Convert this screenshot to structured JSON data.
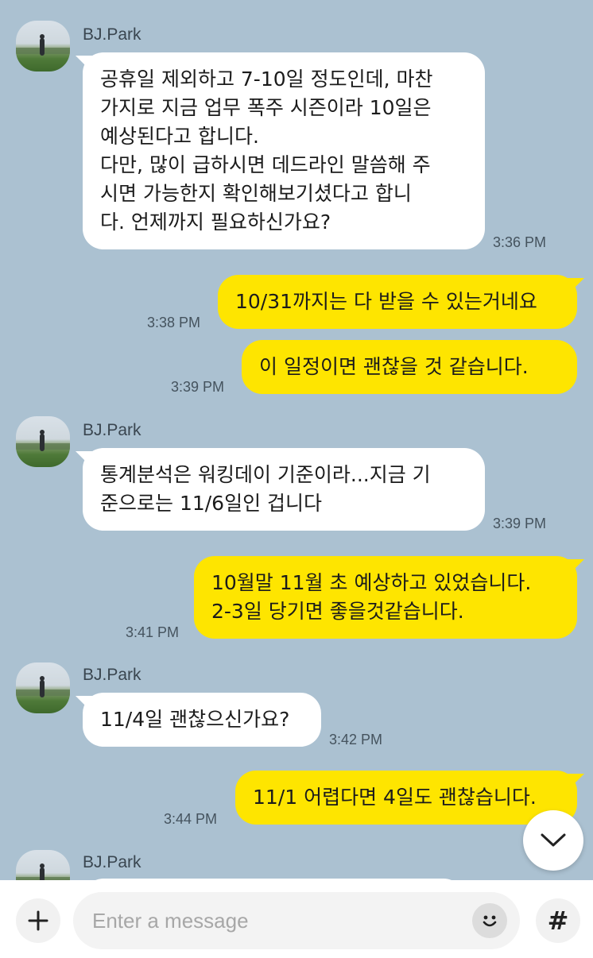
{
  "colors": {
    "background": "#abc1d1",
    "incoming_bubble": "#ffffff",
    "outgoing_bubble": "#fee500",
    "time_text": "#45535e"
  },
  "messages": [
    {
      "sender": "BJ.Park",
      "direction": "incoming",
      "lines": [
        "공휴일 제외하고 7-10일 정도인데, 마찬",
        "가지로 지금 업무 폭주 시즌이라 10일은",
        "예상된다고 합니다.",
        "다만, 많이 급하시면 데드라인 말씀해 주",
        "시면 가능한지 확인해보기셨다고 합니",
        "다. 언제까지 필요하신가요?"
      ],
      "time": "3:36 PM"
    },
    {
      "direction": "outgoing",
      "lines": [
        "10/31까지는 다 받을 수 있는거네요"
      ],
      "time": "3:38 PM"
    },
    {
      "direction": "outgoing",
      "lines": [
        "이 일정이면 괜찮을 것 같습니다."
      ],
      "time": "3:39 PM"
    },
    {
      "sender": "BJ.Park",
      "direction": "incoming",
      "lines": [
        "통계분석은 워킹데이 기준이라...지금 기",
        "준으로는 11/6일인 겁니다"
      ],
      "time": "3:39 PM"
    },
    {
      "direction": "outgoing",
      "lines": [
        "10월말 11월 초 예상하고 있었습니다.",
        "2-3일 당기면 좋을것같습니다."
      ],
      "time": "3:41 PM"
    },
    {
      "sender": "BJ.Park",
      "direction": "incoming",
      "lines": [
        "11/4일 괜찮으신가요?"
      ],
      "time": "3:42 PM"
    },
    {
      "direction": "outgoing",
      "lines": [
        "11/1 어렵다면 4일도 괜찮습니다."
      ],
      "time": "3:44 PM"
    },
    {
      "sender": "BJ.Park",
      "direction": "incoming",
      "lines": [],
      "time": ""
    }
  ],
  "input": {
    "placeholder": "Enter a message",
    "value": ""
  },
  "icons": {
    "add": "plus-icon",
    "emoji": "smile-icon",
    "hashtag": "hash-icon",
    "scroll_down": "chevron-down-icon"
  },
  "labels": {
    "hash": "#"
  }
}
